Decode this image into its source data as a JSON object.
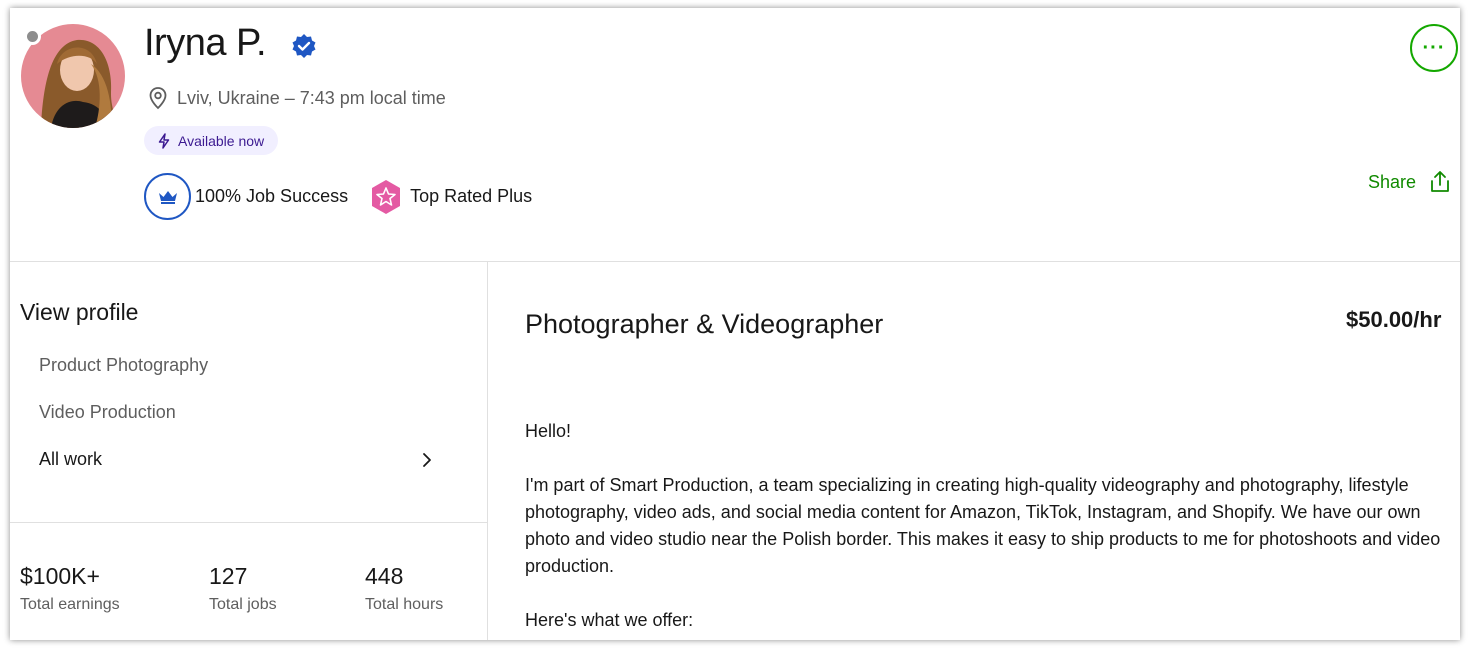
{
  "header": {
    "name": "Iryna P.",
    "location": "Lviv, Ukraine – 7:43 pm local time",
    "availability": "Available now",
    "job_success": "100% Job Success",
    "top_rated": "Top Rated Plus",
    "share_label": "Share",
    "more_label": "···"
  },
  "sidebar": {
    "heading": "View profile",
    "items": [
      {
        "label": "Product Photography"
      },
      {
        "label": "Video Production"
      },
      {
        "label": "All work"
      }
    ],
    "stats": [
      {
        "value": "$100K+",
        "label": "Total earnings"
      },
      {
        "value": "127",
        "label": "Total jobs"
      },
      {
        "value": "448",
        "label": "Total hours"
      }
    ]
  },
  "main": {
    "title": "Photographer & Videographer",
    "rate": "$50.00/hr",
    "paragraphs": [
      "Hello!",
      "I'm part of Smart Production, a team specializing in creating high-quality videography and photography, lifestyle photography, video ads, and social media content for Amazon, TikTok, Instagram, and Shopify. We have our own photo and video studio near the Polish border. This makes it easy to ship products to me for photoshoots and video production.",
      "Here's what we offer:"
    ]
  },
  "colors": {
    "accent_green": "#14a800",
    "verified_blue": "#1f57c3",
    "available_bg": "#f1efff",
    "top_rated_pink": "#e45aa3"
  }
}
